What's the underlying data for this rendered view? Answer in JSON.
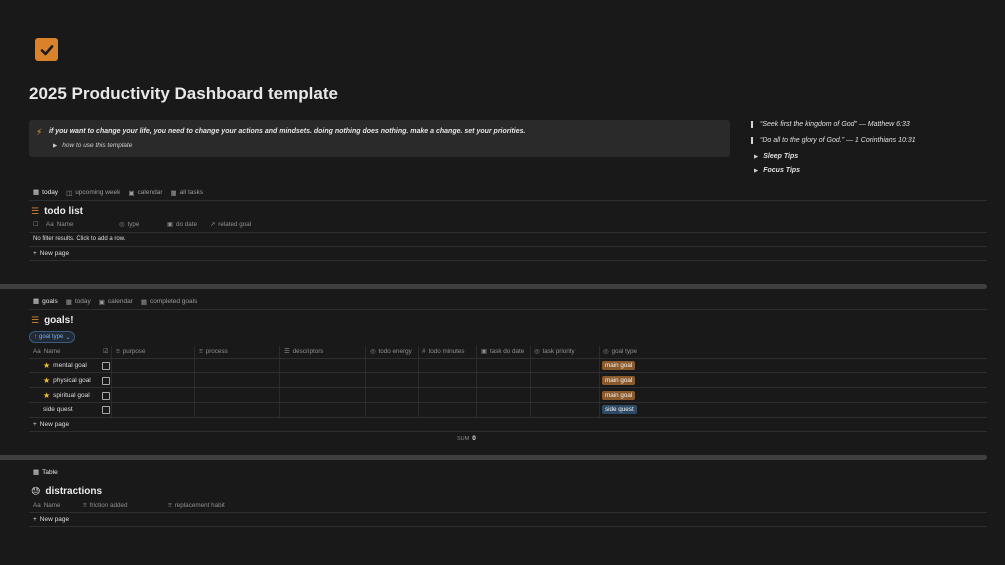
{
  "page": {
    "title": "2025 Productivity Dashboard template",
    "icon": "checkbox-icon",
    "accent": "#d9822b"
  },
  "callout": {
    "icon": "lightning-icon",
    "text": "if you want to change your life, you need to change your actions and mindsets. doing nothing does nothing. make a change. set your priorities.",
    "toggle": "how to use this template"
  },
  "sidebar": {
    "quotes": [
      "“Seek first the kingdom of God” — Matthew 6:33",
      "“Do all to the glory of God.” — 1 Corinthians 10:31"
    ],
    "toggles": [
      "Sleep Tips",
      "Focus Tips"
    ]
  },
  "todo": {
    "tabs": [
      "today",
      "upcoming week",
      "calendar",
      "all tasks"
    ],
    "title": "todo list",
    "columns": [
      "Name",
      "type",
      "do date",
      "related goal"
    ],
    "empty": "No filter results. Click to add a row.",
    "new_page": "New page"
  },
  "goals": {
    "tabs": [
      "goals",
      "today",
      "calendar",
      "completed goals"
    ],
    "title": "goals!",
    "filter": "goal type",
    "columns": [
      "Name",
      "purpose",
      "process",
      "descriptors",
      "todo energy",
      "todo minutes",
      "task do date",
      "task priority",
      "goal type"
    ],
    "rows": [
      {
        "name": "mental goal",
        "star": true,
        "goal_type": "main goal"
      },
      {
        "name": "physical goal",
        "star": true,
        "goal_type": "main goal"
      },
      {
        "name": "spiritual goal",
        "star": true,
        "goal_type": "main goal"
      },
      {
        "name": "side quest",
        "star": false,
        "goal_type": "side quest"
      }
    ],
    "tag_colors": {
      "main goal": "#8a5a2b",
      "side quest": "#2f4a66"
    },
    "new_page": "New page",
    "sum_label": "SUM",
    "sum_value": "0"
  },
  "distractions": {
    "tabs": [
      "Table"
    ],
    "title": "distractions",
    "columns": [
      "Name",
      "friction added",
      "replacement habit"
    ],
    "new_page": "New page"
  }
}
